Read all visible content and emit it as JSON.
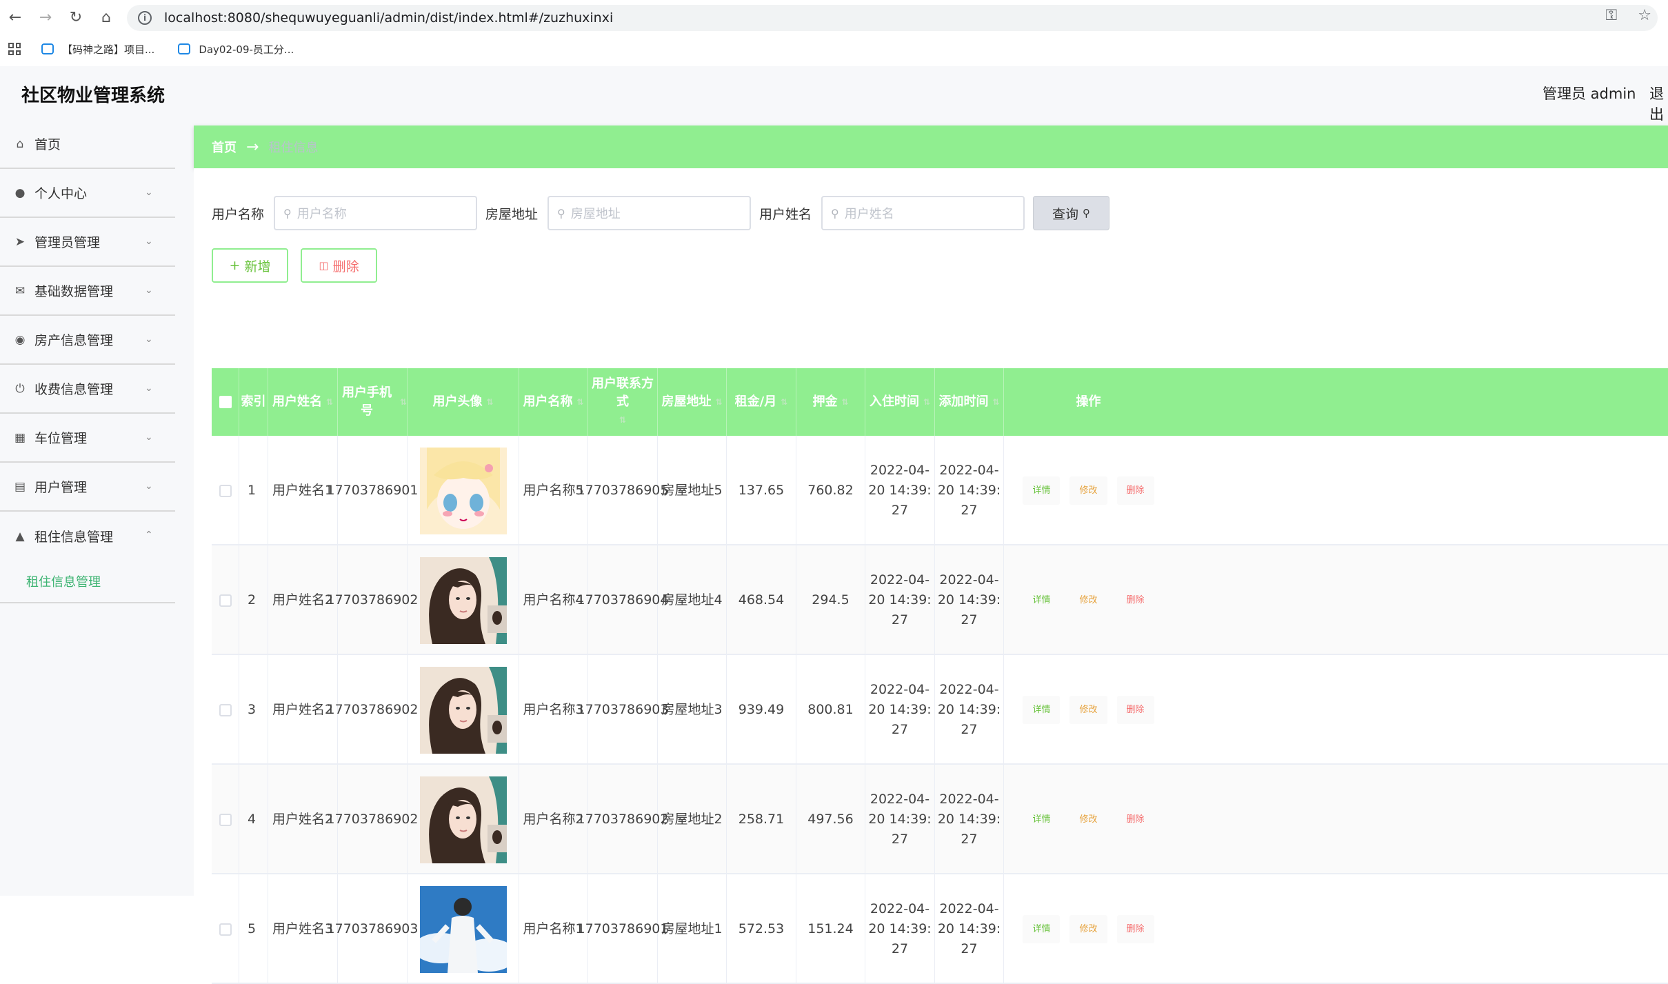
{
  "browser": {
    "url": "localhost:8080/shequwuyeguanli/admin/dist/index.html#/zuzhuxinxi",
    "bookmarks": [
      "【码神之路】项目...",
      "Day02-09-员工分..."
    ]
  },
  "header": {
    "title": "社区物业管理系统",
    "admin_label": "管理员 admin",
    "logout": "退出"
  },
  "sidebar": {
    "items": [
      {
        "label": "首页",
        "icon": "home-icon"
      },
      {
        "label": "个人中心",
        "icon": "user-icon"
      },
      {
        "label": "管理员管理",
        "icon": "send-icon"
      },
      {
        "label": "基础数据管理",
        "icon": "mail-icon"
      },
      {
        "label": "房产信息管理",
        "icon": "compass-icon"
      },
      {
        "label": "收费信息管理",
        "icon": "power-icon"
      },
      {
        "label": "车位管理",
        "icon": "delete-icon"
      },
      {
        "label": "用户管理",
        "icon": "printer-icon"
      },
      {
        "label": "租住信息管理",
        "icon": "stamp-icon"
      }
    ],
    "submenu": {
      "label": "租住信息管理"
    }
  },
  "breadcrumb": {
    "home": "首页",
    "arrow": "→",
    "current": "租住信息"
  },
  "search": {
    "label1": "用户名称",
    "placeholder1": "用户名称",
    "label2": "房屋地址",
    "placeholder2": "房屋地址",
    "label3": "用户姓名",
    "placeholder3": "用户姓名",
    "query_label": "查询"
  },
  "actions": {
    "add_label": "新增",
    "delete_label": "删除"
  },
  "table": {
    "columns": [
      "索引",
      "用户姓名",
      "用户手机号",
      "用户头像",
      "用户名称",
      "用户联系方式",
      "房屋地址",
      "租金/月",
      "押金",
      "入住时间",
      "添加时间",
      "操作"
    ],
    "rows": [
      {
        "index": "1",
        "name": "用户姓名1",
        "phone": "17703786901",
        "avatar": "anime-girl",
        "username": "用户名称5",
        "contact": "17703786905",
        "address": "房屋地址5",
        "rent": "137.65",
        "deposit": "760.82",
        "checkin": "2022-04-20 14:39:27",
        "added": "2022-04-20 14:39:27"
      },
      {
        "index": "2",
        "name": "用户姓名2",
        "phone": "17703786902",
        "avatar": "woman-portrait",
        "username": "用户名称4",
        "contact": "17703786904",
        "address": "房屋地址4",
        "rent": "468.54",
        "deposit": "294.5",
        "checkin": "2022-04-20 14:39:27",
        "added": "2022-04-20 14:39:27"
      },
      {
        "index": "3",
        "name": "用户姓名2",
        "phone": "17703786902",
        "avatar": "woman-portrait",
        "username": "用户名称3",
        "contact": "17703786903",
        "address": "房屋地址3",
        "rent": "939.49",
        "deposit": "800.81",
        "checkin": "2022-04-20 14:39:27",
        "added": "2022-04-20 14:39:27"
      },
      {
        "index": "4",
        "name": "用户姓名2",
        "phone": "17703786902",
        "avatar": "woman-portrait",
        "username": "用户名称2",
        "contact": "17703786902",
        "address": "房屋地址2",
        "rent": "258.71",
        "deposit": "497.56",
        "checkin": "2022-04-20 14:39:27",
        "added": "2022-04-20 14:39:27"
      },
      {
        "index": "5",
        "name": "用户姓名3",
        "phone": "17703786903",
        "avatar": "boy-sky",
        "username": "用户名称1",
        "contact": "17703786901",
        "address": "房屋地址1",
        "rent": "572.53",
        "deposit": "151.24",
        "checkin": "2022-04-20 14:39:27",
        "added": "2022-04-20 14:39:27"
      }
    ],
    "ops": {
      "detail": "详情",
      "edit": "修改",
      "remove": "删除"
    }
  },
  "colors": {
    "accent_green": "#90ee90",
    "active_text": "#3cb371",
    "edit_orange": "#e6a23c",
    "danger_red": "#f56c6c"
  }
}
